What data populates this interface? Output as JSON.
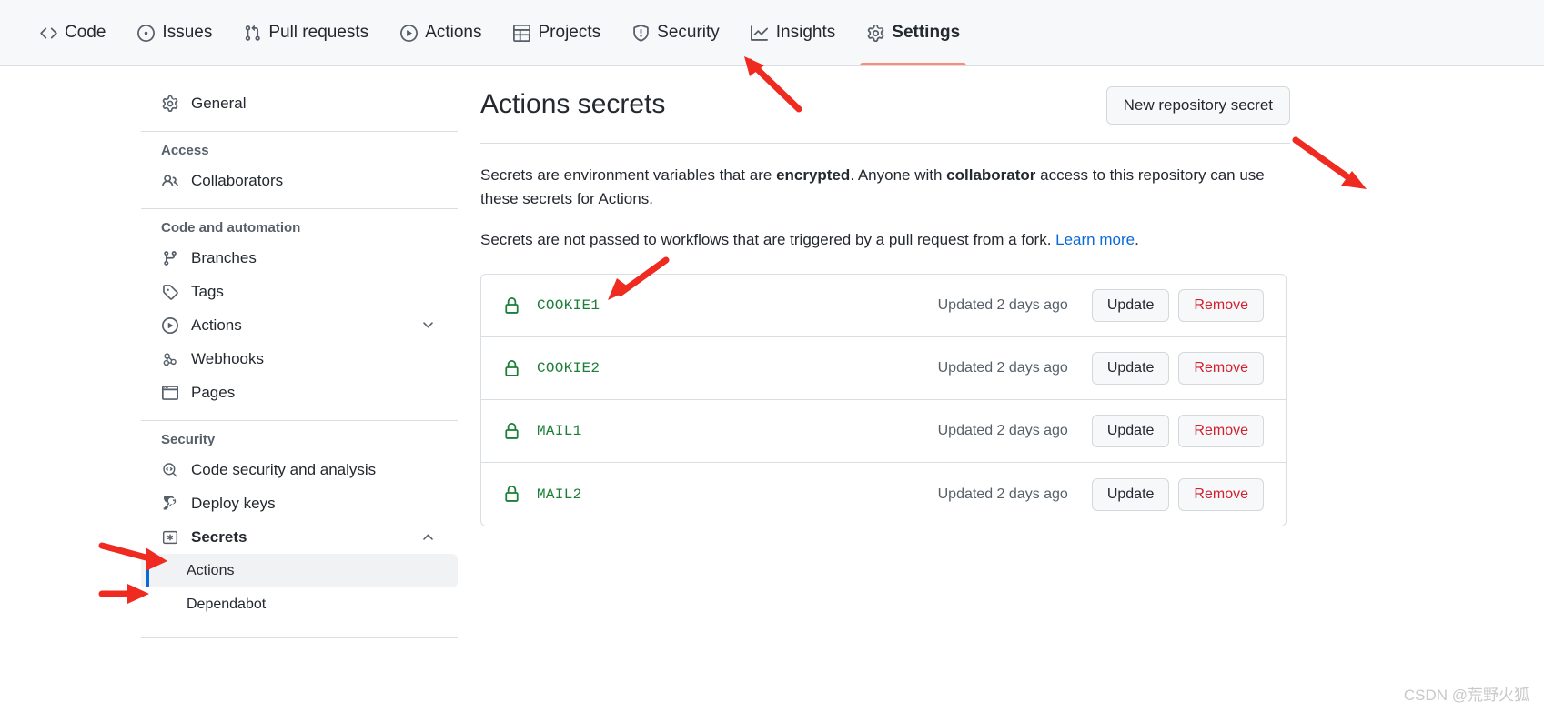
{
  "topnav": {
    "items": [
      {
        "label": "Code",
        "icon": "code-icon",
        "active": false
      },
      {
        "label": "Issues",
        "icon": "issue-opened-icon",
        "active": false
      },
      {
        "label": "Pull requests",
        "icon": "git-pull-request-icon",
        "active": false
      },
      {
        "label": "Actions",
        "icon": "play-icon",
        "active": false
      },
      {
        "label": "Projects",
        "icon": "table-icon",
        "active": false
      },
      {
        "label": "Security",
        "icon": "shield-icon",
        "active": false
      },
      {
        "label": "Insights",
        "icon": "graph-icon",
        "active": false
      },
      {
        "label": "Settings",
        "icon": "gear-icon",
        "active": true
      }
    ]
  },
  "sidebar": {
    "general": {
      "label": "General",
      "icon": "gear-icon"
    },
    "groups": [
      {
        "title": "Access",
        "items": [
          {
            "label": "Collaborators",
            "icon": "people-icon"
          }
        ]
      },
      {
        "title": "Code and automation",
        "items": [
          {
            "label": "Branches",
            "icon": "git-branch-icon"
          },
          {
            "label": "Tags",
            "icon": "tag-icon"
          },
          {
            "label": "Actions",
            "icon": "play-icon",
            "chevron": "chevron-down"
          },
          {
            "label": "Webhooks",
            "icon": "webhook-icon"
          },
          {
            "label": "Pages",
            "icon": "browser-icon"
          }
        ]
      },
      {
        "title": "Security",
        "items": [
          {
            "label": "Code security and analysis",
            "icon": "code-review-icon"
          },
          {
            "label": "Deploy keys",
            "icon": "key-icon"
          },
          {
            "label": "Secrets",
            "icon": "asterisk-icon",
            "chevron": "chevron-up",
            "bold": true
          }
        ],
        "subitems": [
          {
            "label": "Actions",
            "selected": true
          },
          {
            "label": "Dependabot",
            "selected": false
          }
        ]
      }
    ]
  },
  "main": {
    "title": "Actions secrets",
    "new_secret_button": "New repository secret",
    "description_1": {
      "part1": "Secrets are environment variables that are ",
      "bold1": "encrypted",
      "part2": ". Anyone with ",
      "bold2": "collaborator",
      "part3": " access to this repository can use these secrets for Actions."
    },
    "description_2": {
      "text": "Secrets are not passed to workflows that are triggered by a pull request from a fork. ",
      "link": "Learn more",
      "period": "."
    },
    "update_label": "Update",
    "remove_label": "Remove",
    "secrets": [
      {
        "name": "COOKIE1",
        "updated": "Updated 2 days ago"
      },
      {
        "name": "COOKIE2",
        "updated": "Updated 2 days ago"
      },
      {
        "name": "MAIL1",
        "updated": "Updated 2 days ago"
      },
      {
        "name": "MAIL2",
        "updated": "Updated 2 days ago"
      }
    ]
  },
  "watermark": "CSDN @荒野火狐",
  "colors": {
    "accent_blue": "#0969da",
    "active_tab_underline": "#fd8c73",
    "secret_green": "#1a7f37",
    "danger_red": "#cf222e",
    "annotation_red": "#ef2a20"
  }
}
